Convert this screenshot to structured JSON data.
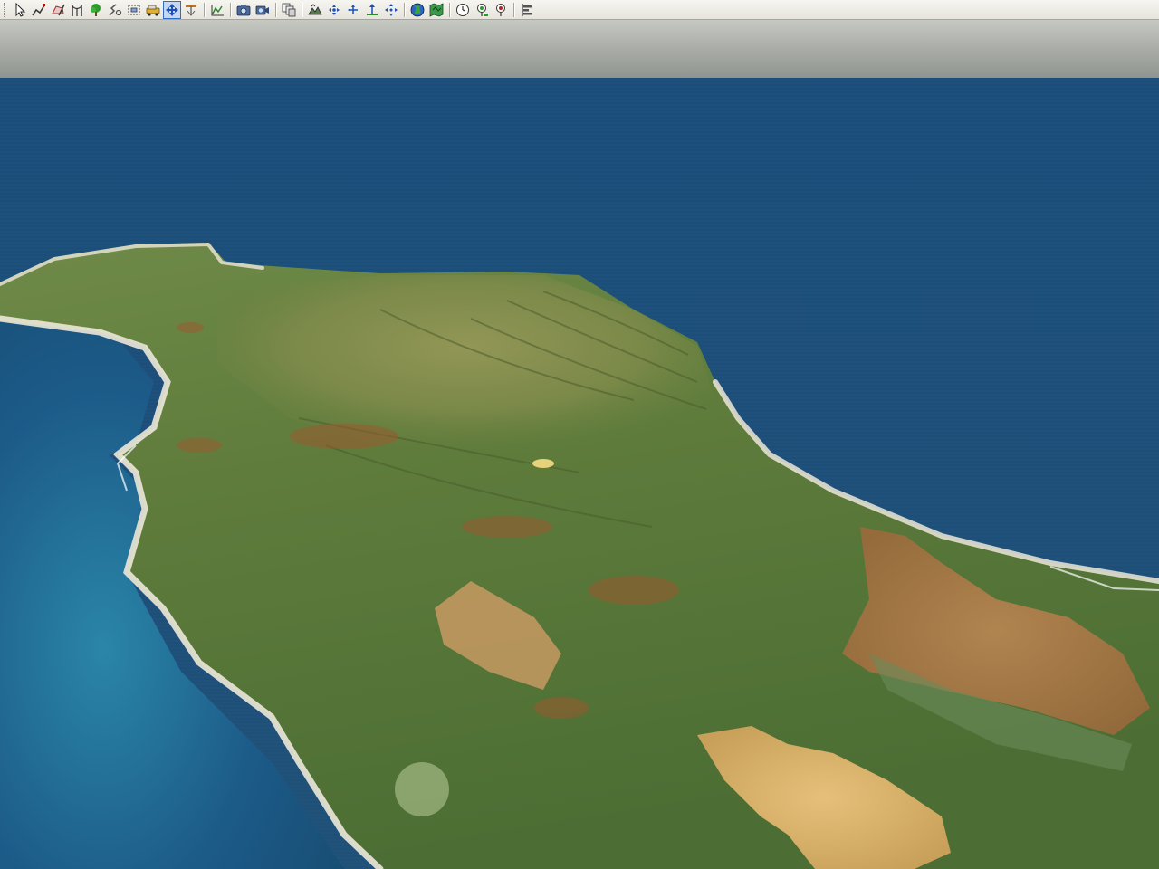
{
  "toolbar": {
    "tools": [
      {
        "id": "select-tool",
        "icon": "arrow-cursor-icon"
      },
      {
        "id": "polyline-tool",
        "icon": "polyline-icon"
      },
      {
        "id": "area-tool",
        "icon": "area-draw-icon"
      },
      {
        "id": "fence-tool",
        "icon": "fence-icon"
      },
      {
        "id": "tree-tool",
        "icon": "tree-icon"
      },
      {
        "id": "path-tool",
        "icon": "path-icon"
      },
      {
        "id": "structure-tool",
        "icon": "structure-icon"
      },
      {
        "id": "vehicle-tool",
        "icon": "vehicle-icon"
      },
      {
        "id": "navigate-tool",
        "icon": "move-icon",
        "active": true
      },
      {
        "id": "slope-tool",
        "icon": "slope-icon"
      },
      {
        "id": "profile-tool",
        "icon": "profile-chart-icon"
      },
      {
        "id": "snapshot-tool",
        "icon": "camera-icon"
      },
      {
        "id": "record-tool",
        "icon": "video-camera-icon"
      },
      {
        "id": "layers-tool",
        "icon": "layers-icon"
      },
      {
        "id": "terrain-tool",
        "icon": "terrain-icon"
      },
      {
        "id": "pan-tool",
        "icon": "pan-icon"
      },
      {
        "id": "zoom-tool",
        "icon": "zoom-icon"
      },
      {
        "id": "elevate-tool",
        "icon": "elevate-icon"
      },
      {
        "id": "orbit-tool",
        "icon": "orbit-icon"
      },
      {
        "id": "globe-tool",
        "icon": "globe-icon"
      },
      {
        "id": "map-tool",
        "icon": "map-icon"
      },
      {
        "id": "clock-tool",
        "icon": "clock-icon"
      },
      {
        "id": "marker-add-tool",
        "icon": "marker-green-icon"
      },
      {
        "id": "marker-remove-tool",
        "icon": "marker-red-icon"
      },
      {
        "id": "properties-tool",
        "icon": "properties-icon"
      }
    ]
  },
  "scene": {
    "sky_color": "#b4b6b0",
    "sea_color": "#1c4d75",
    "land_color": "#5c7a3a",
    "beach_color": "#e8e4d4"
  }
}
